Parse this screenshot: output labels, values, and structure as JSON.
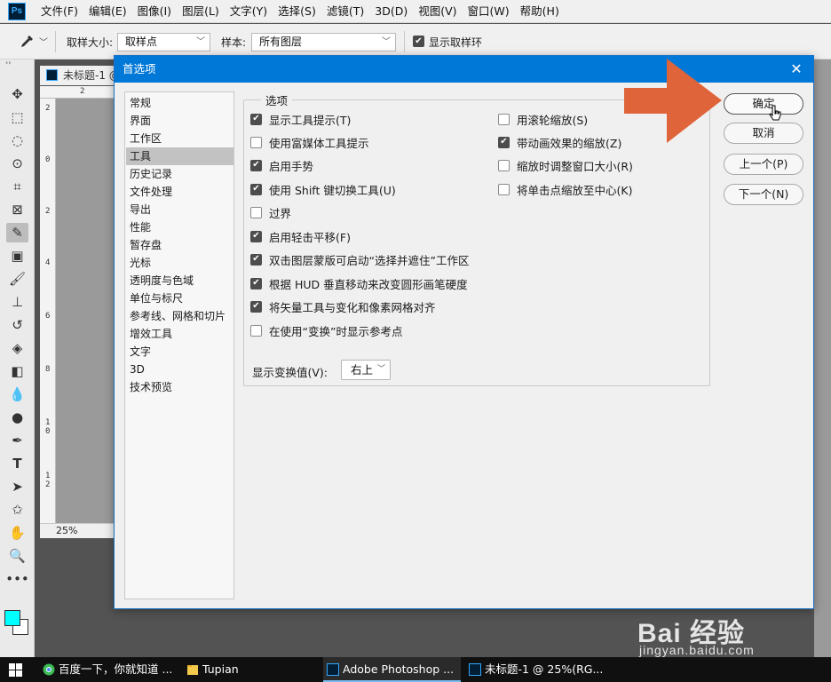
{
  "app": {
    "logo": "Ps",
    "menu": [
      "文件(F)",
      "编辑(E)",
      "图像(I)",
      "图层(L)",
      "文字(Y)",
      "选择(S)",
      "滤镜(T)",
      "3D(D)",
      "视图(V)",
      "窗口(W)",
      "帮助(H)"
    ]
  },
  "options_bar": {
    "tool_icon": "eyedropper-icon",
    "sample_size_label": "取样大小:",
    "sample_size_value": "取样点",
    "sample_label": "样本:",
    "sample_value": "所有图层",
    "show_ring_label": "显示取样环",
    "show_ring_checked": true
  },
  "toolbar": {
    "tools": [
      "move-icon",
      "marquee-icon",
      "lasso-icon",
      "quick-select-icon",
      "crop-icon",
      "frame-icon",
      "eyedropper-icon",
      "healing-icon",
      "brush-icon",
      "stamp-icon",
      "history-brush-icon",
      "eraser-icon",
      "gradient-icon",
      "blur-icon",
      "dodge-icon",
      "pen-icon",
      "type-icon",
      "path-select-icon",
      "shape-icon",
      "hand-icon",
      "zoom-icon",
      "more-icon"
    ],
    "active_tool": "eyedropper-icon",
    "foreground_color": "#00ffff",
    "background_color": "#ffffff"
  },
  "document": {
    "tab_title": "未标题-1 @",
    "zoom": "25%",
    "ruler_top": "2",
    "ruler_left": [
      "2",
      "0",
      "2",
      "4",
      "6",
      "8",
      "1 0",
      "1 2"
    ]
  },
  "dialog": {
    "title": "首选项",
    "close_icon": "close-icon",
    "nav": [
      "常规",
      "界面",
      "工作区",
      "工具",
      "历史记录",
      "文件处理",
      "导出",
      "性能",
      "暂存盘",
      "光标",
      "透明度与色域",
      "单位与标尺",
      "参考线、网格和切片",
      "增效工具",
      "文字",
      "3D",
      "技术预览"
    ],
    "nav_selected": "工具",
    "group_title": "选项",
    "left_options": [
      {
        "label": "显示工具提示(T)",
        "checked": true
      },
      {
        "label": "使用富媒体工具提示",
        "checked": false
      },
      {
        "label": "启用手势",
        "checked": true
      },
      {
        "label": "使用 Shift 键切换工具(U)",
        "checked": true
      },
      {
        "label": "过界",
        "checked": false
      },
      {
        "label": "启用轻击平移(F)",
        "checked": true
      },
      {
        "label": "双击图层蒙版可启动“选择并遮住”工作区",
        "checked": true
      },
      {
        "label": "根据 HUD 垂直移动来改变圆形画笔硬度",
        "checked": true
      },
      {
        "label": "将矢量工具与变化和像素网格对齐",
        "checked": true
      },
      {
        "label": "在使用“变换”时显示参考点",
        "checked": false
      }
    ],
    "right_options": [
      {
        "label": "用滚轮缩放(S)",
        "checked": false
      },
      {
        "label": "带动画效果的缩放(Z)",
        "checked": true
      },
      {
        "label": "缩放时调整窗口大小(R)",
        "checked": false
      },
      {
        "label": "将单击点缩放至中心(K)",
        "checked": false
      }
    ],
    "transform_label": "显示变换值(V):",
    "transform_value": "右上",
    "buttons": {
      "ok": "确定",
      "cancel": "取消",
      "prev": "上一个(P)",
      "next": "下一个(N)"
    }
  },
  "annotation": {
    "arrow_color": "#e0643a"
  },
  "taskbar": {
    "items": [
      {
        "label": "百度一下，你就知道 ...",
        "icon": "chrome-icon"
      },
      {
        "label": "Tupian",
        "icon": "folder-icon"
      },
      {
        "label": "Adobe Photoshop ...",
        "icon": "photoshop-icon"
      },
      {
        "label": "未标题-1 @ 25%(RG...",
        "icon": "photoshop-icon"
      }
    ]
  },
  "watermark": {
    "main": "Bai 经验",
    "sub": "jingyan.baidu.com"
  }
}
